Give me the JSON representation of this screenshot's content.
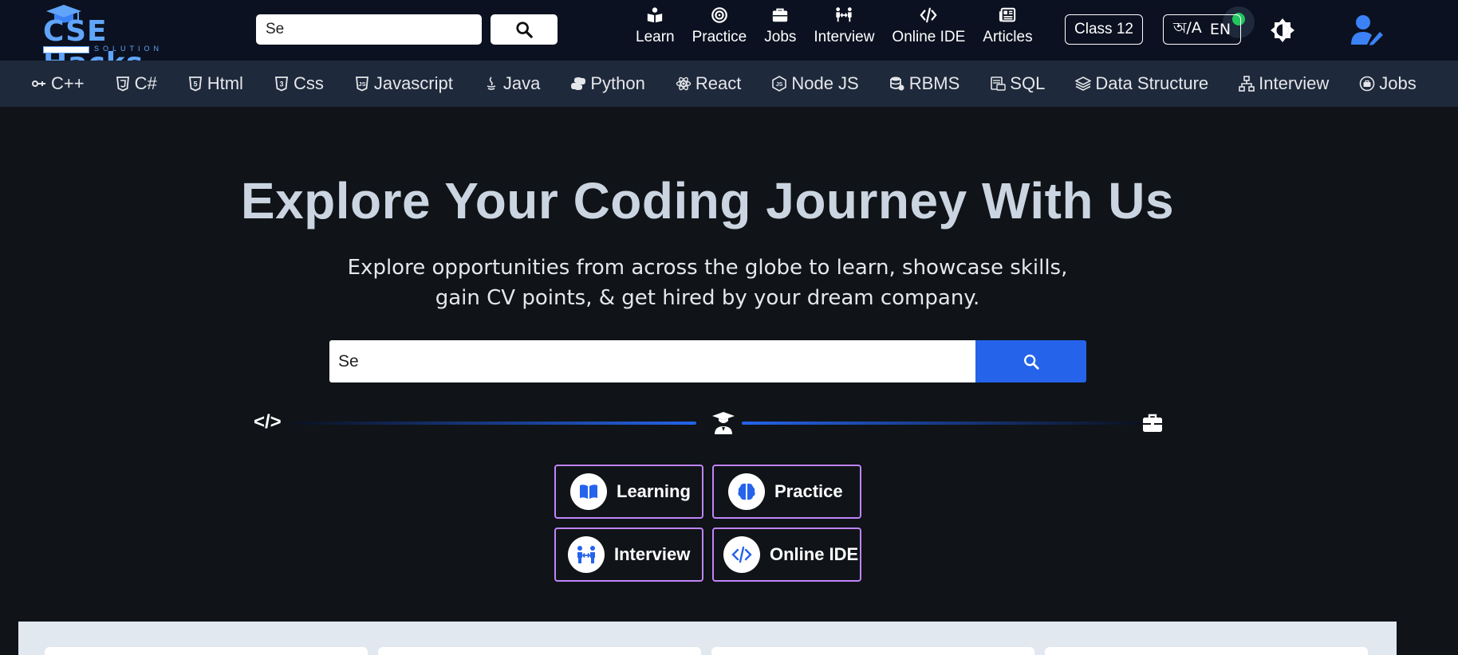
{
  "brand": {
    "name": "CSE Hacks",
    "tagline": "SOLUTION",
    "color": "#60a5fa"
  },
  "header": {
    "search": {
      "placeholder": "Search",
      "value": "Se"
    },
    "nav": [
      {
        "label": "Learn",
        "icon": "book-reader-icon"
      },
      {
        "label": "Practice",
        "icon": "target-icon"
      },
      {
        "label": "Jobs",
        "icon": "briefcase-icon"
      },
      {
        "label": "Interview",
        "icon": "people-arrows-icon"
      },
      {
        "label": "Online IDE",
        "icon": "code-icon"
      },
      {
        "label": "Articles",
        "icon": "newspaper-icon"
      }
    ],
    "class_button": "Class 12",
    "language": {
      "bn": "অ/A",
      "en": "EN"
    }
  },
  "topics": [
    {
      "label": "C++",
      "icon": "cpp-icon"
    },
    {
      "label": "C#",
      "icon": "css3-icon"
    },
    {
      "label": "Html",
      "icon": "html5-icon"
    },
    {
      "label": "Css",
      "icon": "css3-icon"
    },
    {
      "label": "Javascript",
      "icon": "js-icon"
    },
    {
      "label": "Java",
      "icon": "java-icon"
    },
    {
      "label": "Python",
      "icon": "python-icon"
    },
    {
      "label": "React",
      "icon": "react-icon"
    },
    {
      "label": "Node JS",
      "icon": "nodejs-icon"
    },
    {
      "label": "RBMS",
      "icon": "database-icon"
    },
    {
      "label": "SQL",
      "icon": "sql-icon"
    },
    {
      "label": "Data Structure",
      "icon": "layers-icon"
    },
    {
      "label": "Interview",
      "icon": "diagram-icon"
    },
    {
      "label": "Jobs",
      "icon": "briefcase-circle-icon"
    }
  ],
  "hero": {
    "title": "Explore Your Coding Journey With Us",
    "subtitle_line1": "Explore opportunities from across the globe to learn, showcase skills,",
    "subtitle_line2": "gain CV points, & get hired by your dream company.",
    "search": {
      "placeholder": "Search",
      "value": "Se"
    },
    "path_code_label": "</>"
  },
  "features": [
    {
      "label": "Learning",
      "icon": "book-open-icon"
    },
    {
      "label": "Practice",
      "icon": "brain-icon"
    },
    {
      "label": "Interview",
      "icon": "people-arrows-icon"
    },
    {
      "label": "Online IDE",
      "icon": "code-icon"
    }
  ],
  "colors": {
    "header_bg": "#0b1120",
    "topic_bar_bg": "#1e293b",
    "page_bg": "#101418",
    "accent_blue": "#2563eb",
    "feature_border": "#c084fc",
    "status_green": "#22c55e"
  }
}
